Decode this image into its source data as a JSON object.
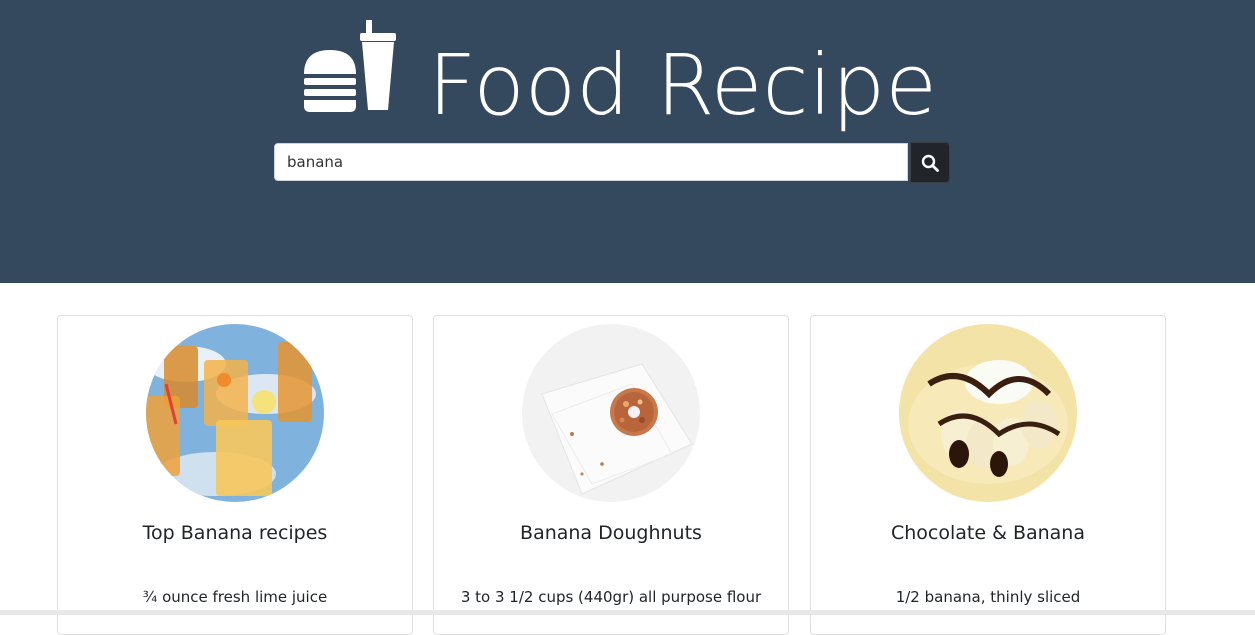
{
  "header": {
    "title": "Food Recipe",
    "logo_icon": "burger-drink-icon",
    "background_color": "#34495e"
  },
  "search": {
    "value": "banana",
    "placeholder": "",
    "button_icon": "search-icon"
  },
  "cards": [
    {
      "title": "Top Banana recipes",
      "text": "¾ ounce fresh lime juice",
      "image": "iced-drinks-photo"
    },
    {
      "title": "Banana Doughnuts",
      "text": "3 to 3 1/2 cups (440gr) all purpose flour",
      "image": "doughnut-photo"
    },
    {
      "title": "Chocolate & Banana",
      "text": "1/2 banana, thinly sliced",
      "image": "chocolate-banana-crepe-photo"
    }
  ]
}
